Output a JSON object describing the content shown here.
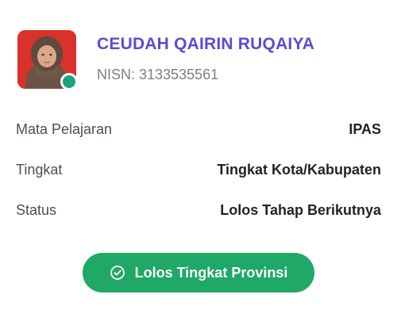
{
  "profile": {
    "name": "CEUDAH QAIRIN RUQAIYA",
    "nisn": "NISN: 3133535561",
    "online_status_color": "#1aa37a",
    "avatar_background": "#d9312b"
  },
  "details": [
    {
      "label": "Mata Pelajaran",
      "value": "IPAS"
    },
    {
      "label": "Tingkat",
      "value": "Tingkat Kota/Kabupaten"
    },
    {
      "label": "Status",
      "value": "Lolos Tahap Berikutnya"
    }
  ],
  "action": {
    "label": "Lolos Tingkat Provinsi",
    "icon": "check-circle-icon",
    "color": "#1fa866"
  },
  "colors": {
    "name": "#5b4bd4",
    "label": "#4a4f56",
    "value": "#1f2328"
  }
}
